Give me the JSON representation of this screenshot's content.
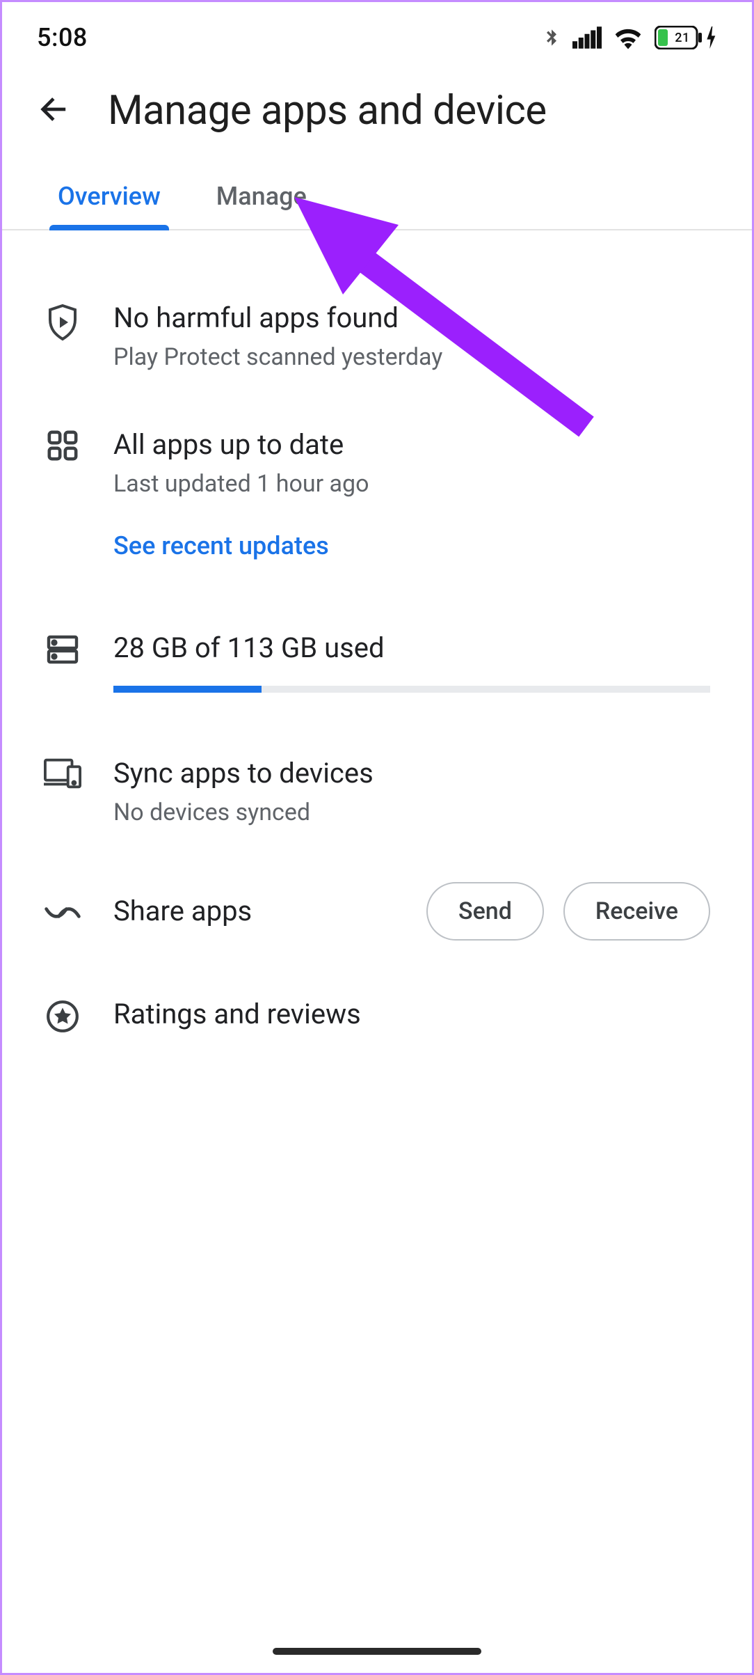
{
  "status": {
    "time": "5:08",
    "battery_pct": "21"
  },
  "header": {
    "title": "Manage apps and device"
  },
  "tabs": {
    "overview": "Overview",
    "manage": "Manage"
  },
  "protect": {
    "title": "No harmful apps found",
    "subtitle": "Play Protect scanned yesterday"
  },
  "updates": {
    "title": "All apps up to date",
    "subtitle": "Last updated 1 hour ago",
    "link": "See recent updates"
  },
  "storage": {
    "label": "28 GB of 113 GB used",
    "used_gb": 28,
    "total_gb": 113
  },
  "sync": {
    "title": "Sync apps to devices",
    "subtitle": "No devices synced"
  },
  "share": {
    "title": "Share apps",
    "send": "Send",
    "receive": "Receive"
  },
  "ratings": {
    "title": "Ratings and reviews"
  },
  "colors": {
    "accent": "#1a73e8",
    "annotation": "#9b20fd"
  }
}
